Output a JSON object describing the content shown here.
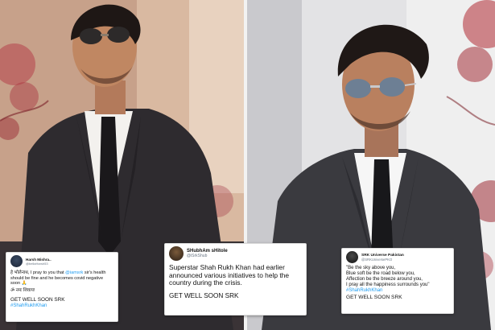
{
  "tweets": [
    {
      "name": "Harsh Mishra..",
      "handle": "@bellaHarsh53",
      "lines": [
        "हे भोलेनाथ, I pray to you that",
        "@iamsrk",
        "sir's health should be fine and he becomes covid negative soon 🙏",
        "ॐ नमः शिवाय!"
      ],
      "closing": "GET WELL SOON SRK",
      "hashtag": "#ShahRukhKhan"
    },
    {
      "name": "SHubhAm sHitole",
      "handle": "@iSrkShub",
      "lines": [
        "Superstar Shah Rukh Khan had earlier announced various initiatives to help the country during the crisis."
      ],
      "closing": "GET WELL SOON SRK"
    },
    {
      "name": "SRK Universe Pakistan",
      "handle": "@SRKUniversePKO",
      "lines": [
        "\"Be the sky above you,",
        "Blue soft be the road below you,",
        "Affection be the breeze around you,",
        "I pray all the happiness surrounds you\""
      ],
      "hashtag": "#ShahRukhKhan",
      "closing": "GET WELL SOON SRK"
    }
  ]
}
